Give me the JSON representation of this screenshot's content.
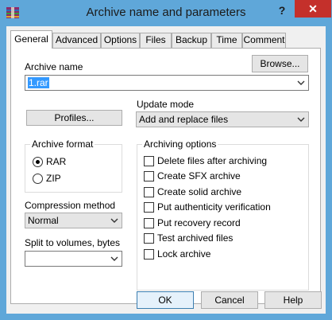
{
  "window": {
    "title": "Archive name and parameters",
    "help_label": "?",
    "close_label": "✕",
    "accent_color": "#5fa7d9",
    "close_color": "#c4302b"
  },
  "tabs": [
    {
      "label": "General",
      "active": true
    },
    {
      "label": "Advanced"
    },
    {
      "label": "Options"
    },
    {
      "label": "Files"
    },
    {
      "label": "Backup"
    },
    {
      "label": "Time"
    },
    {
      "label": "Comment"
    }
  ],
  "general": {
    "archive_name_label": "Archive name",
    "browse_label": "Browse...",
    "archive_name_value": "1.rar",
    "profiles_label": "Profiles...",
    "update_mode_label": "Update mode",
    "update_mode_value": "Add and replace files",
    "archive_format": {
      "title": "Archive format",
      "options": [
        {
          "label": "RAR",
          "selected": true
        },
        {
          "label": "ZIP",
          "selected": false
        }
      ]
    },
    "compression_method_label": "Compression method",
    "compression_method_value": "Normal",
    "split_label": "Split to volumes, bytes",
    "split_value": "",
    "archiving_options": {
      "title": "Archiving options",
      "items": [
        {
          "label": "Delete files after archiving",
          "checked": false
        },
        {
          "label": "Create SFX archive",
          "checked": false
        },
        {
          "label": "Create solid archive",
          "checked": false
        },
        {
          "label": "Put authenticity verification",
          "checked": false
        },
        {
          "label": "Put recovery record",
          "checked": false
        },
        {
          "label": "Test archived files",
          "checked": false
        },
        {
          "label": "Lock archive",
          "checked": false
        }
      ]
    }
  },
  "buttons": {
    "ok": "OK",
    "cancel": "Cancel",
    "help": "Help"
  }
}
